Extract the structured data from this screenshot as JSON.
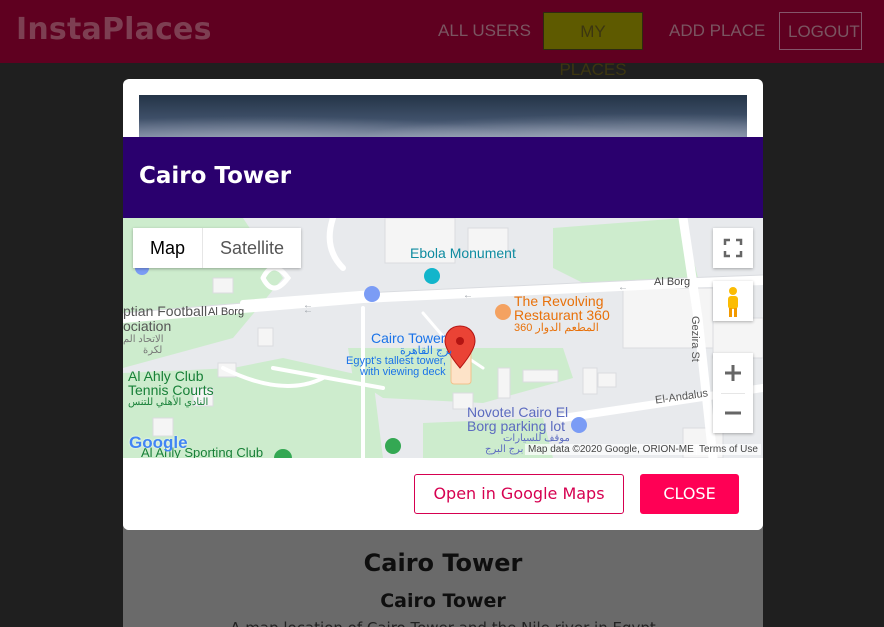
{
  "app": {
    "brand": "InstaPlaces"
  },
  "nav": {
    "all_users": "ALL USERS",
    "my_places": "MY PLACES",
    "add_place": "ADD PLACE",
    "logout": "LOGOUT"
  },
  "modal": {
    "title": "Cairo Tower",
    "open_maps_label": "Open in Google Maps",
    "close_label": "CLOSE"
  },
  "map": {
    "type_map": "Map",
    "type_satellite": "Satellite",
    "labels": {
      "ebola": "Ebola Monument",
      "al_borg_right": "Al Borg",
      "al_borg_left": "Al Borg",
      "revolving_1": "The Revolving",
      "revolving_2": "Restaurant 360",
      "revolving_ar": "المطعم الدوار 360",
      "football_1": "ptian Football",
      "football_2": "ociation",
      "football_ar1": "الاتحاد الم",
      "football_ar2": "لكرة",
      "cairo_tower": "Cairo Tower",
      "cairo_tower_ar": "برج القاهرة",
      "tower_desc_1": "Egypt's tallest tower,",
      "tower_desc_2": "with viewing deck",
      "ahly_1": "Al Ahly Club",
      "ahly_2": "Tennis Courts",
      "ahly_ar": "النادي الأهلي للتنس",
      "gezira": "Gezira St",
      "el_andalus": "El-Andalus",
      "novotel_1": "Novotel Cairo El",
      "novotel_2": "Borg parking lot",
      "novotel_ar1": "موقف للسيارات",
      "novotel_ar2": "برج البرج",
      "sporting": "Al Ahly Sporting Club",
      "google": "Google",
      "attribution": "Map data ©2020 Google, ORION-ME",
      "terms": "Terms of Use"
    }
  },
  "page": {
    "title": "Cairo Tower",
    "subtitle": "Cairo Tower",
    "description": "A map location of Cairo Tower and the Nile river in Egypt"
  },
  "colors": {
    "header_bg": "#5f0020",
    "modal_header_bg": "#2a006e",
    "accent": "#ff0055",
    "map_pin": "#ea4335"
  }
}
